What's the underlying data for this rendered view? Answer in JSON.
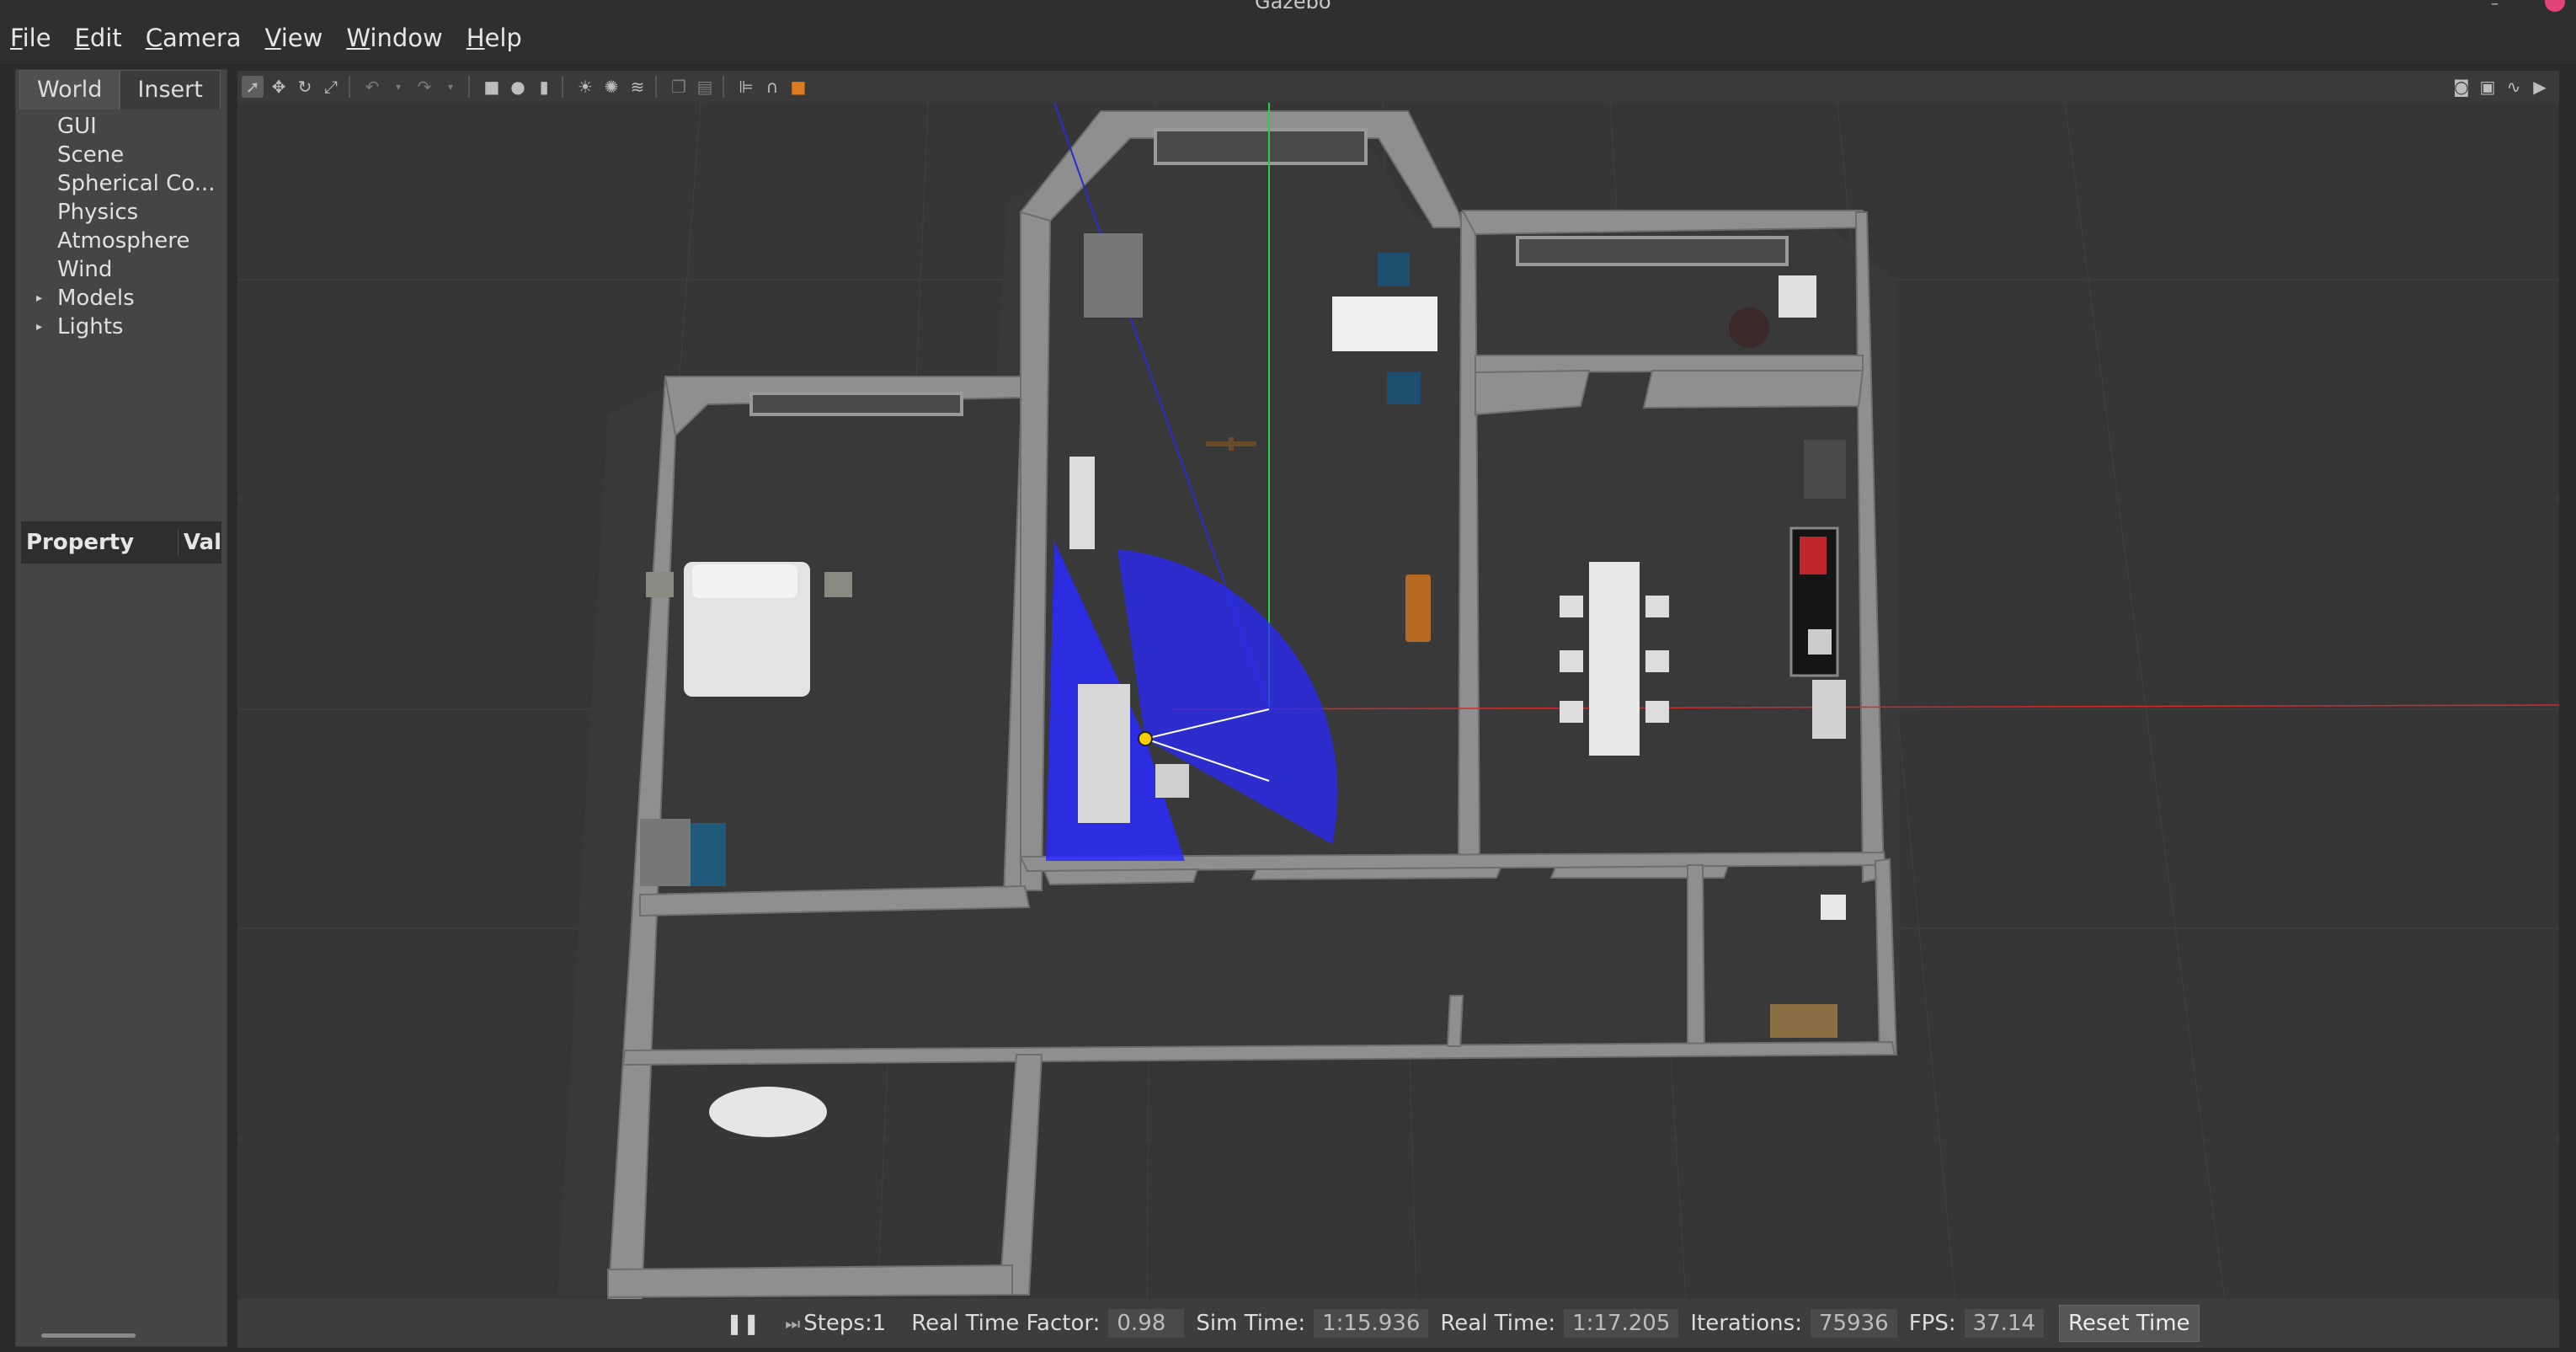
{
  "window": {
    "title": "Gazebo"
  },
  "menu": [
    {
      "label": "File",
      "key": "F"
    },
    {
      "label": "Edit",
      "key": "E"
    },
    {
      "label": "Camera",
      "key": "C"
    },
    {
      "label": "View",
      "key": "V"
    },
    {
      "label": "Window",
      "key": "W"
    },
    {
      "label": "Help",
      "key": "H"
    }
  ],
  "left_panel": {
    "tabs": [
      "World",
      "Insert"
    ],
    "tree": [
      {
        "label": "GUI",
        "expandable": false
      },
      {
        "label": "Scene",
        "expandable": false
      },
      {
        "label": "Spherical Co...",
        "expandable": false
      },
      {
        "label": "Physics",
        "expandable": false
      },
      {
        "label": "Atmosphere",
        "expandable": false
      },
      {
        "label": "Wind",
        "expandable": false
      },
      {
        "label": "Models",
        "expandable": true
      },
      {
        "label": "Lights",
        "expandable": true
      }
    ],
    "property_header": {
      "property": "Property",
      "value": "Val"
    }
  },
  "toolbar": {
    "left": [
      "select-icon",
      "translate-icon",
      "rotate-icon",
      "scale-icon",
      "undo-icon",
      "undo-dropdown-icon",
      "redo-icon",
      "redo-dropdown-icon",
      "box-icon",
      "sphere-icon",
      "cylinder-icon",
      "point-light-icon",
      "spot-light-icon",
      "directional-light-icon",
      "copy-icon",
      "paste-icon",
      "align-icon",
      "snap-icon",
      "color-icon"
    ],
    "right": [
      "screenshot-icon",
      "log-icon",
      "plot-icon",
      "video-icon"
    ]
  },
  "status": {
    "steps_label": "Steps:",
    "steps_value": "1",
    "rtf_label": "Real Time Factor:",
    "rtf_value": "0.98",
    "sim_time_label": "Sim Time:",
    "sim_time_value": "1:15.936",
    "real_time_label": "Real Time:",
    "real_time_value": "1:17.205",
    "iterations_label": "Iterations:",
    "iterations_value": "75936",
    "fps_label": "FPS:",
    "fps_value": "37.14",
    "reset_label": "Reset Time"
  },
  "colors": {
    "laser": "#2a2aff",
    "axis_x": "#d22b2b",
    "axis_y": "#2bd22b",
    "axis_z": "#2b2bd2",
    "wall": "#8f8f8f",
    "ground": "#363636"
  }
}
